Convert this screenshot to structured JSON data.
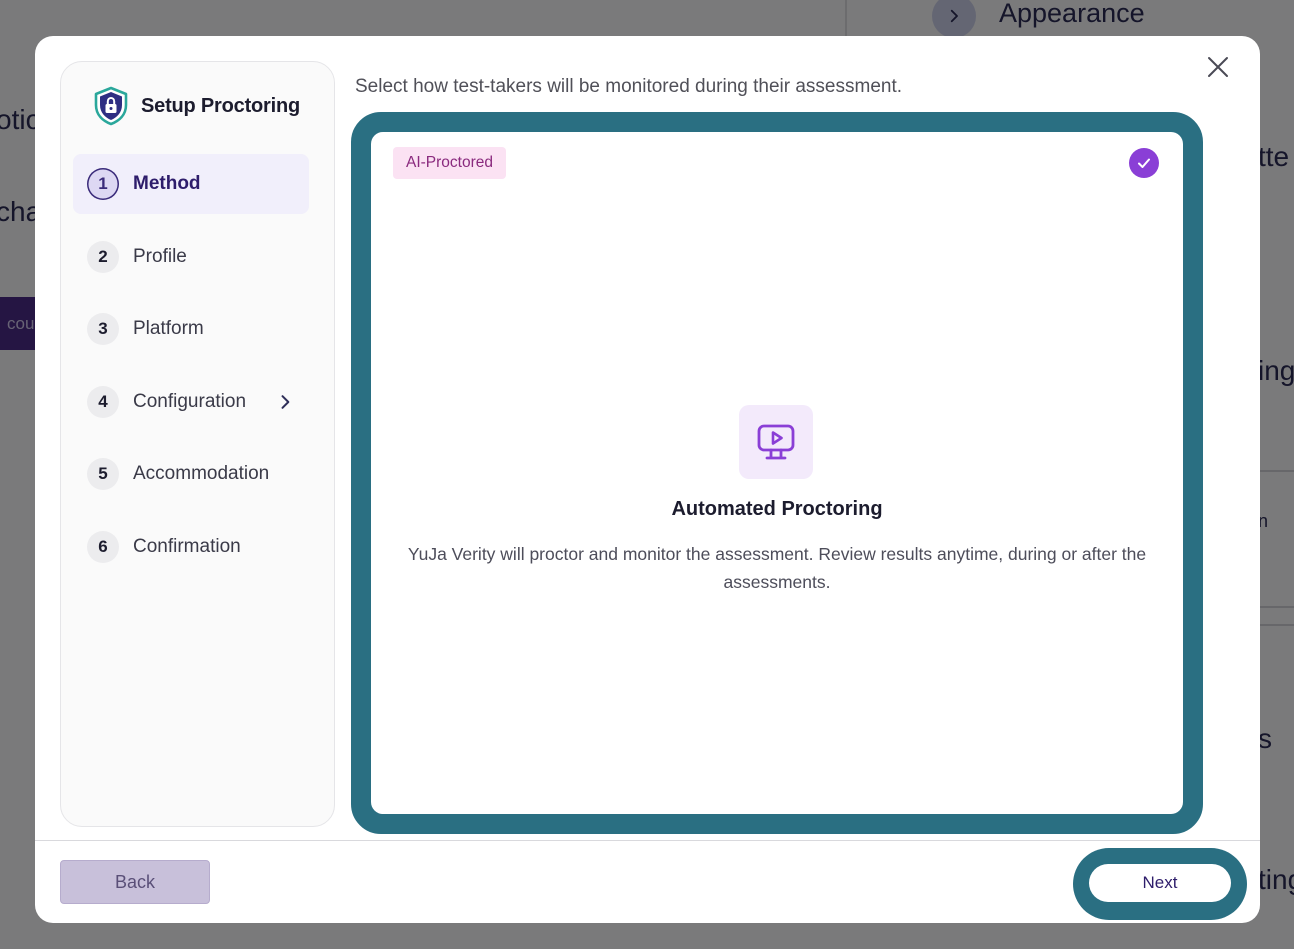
{
  "background": {
    "appearance_label": "Appearance",
    "left_fragments": [
      "otio",
      "char",
      "cou"
    ],
    "right_fragments": [
      "tte",
      "ing",
      "n",
      "s",
      "ting"
    ]
  },
  "modal": {
    "title": "Setup Proctoring",
    "instruction": "Select how test-takers will be monitored during their assessment.",
    "steps": [
      {
        "number": "1",
        "label": "Method"
      },
      {
        "number": "2",
        "label": "Profile"
      },
      {
        "number": "3",
        "label": "Platform"
      },
      {
        "number": "4",
        "label": "Configuration"
      },
      {
        "number": "5",
        "label": "Accommodation"
      },
      {
        "number": "6",
        "label": "Confirmation"
      }
    ],
    "active_step": 1,
    "option": {
      "badge": "AI-Proctored",
      "title": "Automated Proctoring",
      "description": "YuJa Verity will proctor and monitor the assessment. Review results anytime, during or after the assessments.",
      "selected": true
    },
    "footer": {
      "back_label": "Back",
      "next_label": "Next"
    }
  },
  "colors": {
    "accent_purple": "#8a3fd6",
    "focus_teal": "#2a6f82",
    "badge_bg": "#fbe2f3",
    "active_step_bg": "#f1effb"
  },
  "icons": {
    "logo": "shield-lock-icon",
    "close": "close-icon",
    "check": "check-icon",
    "option": "monitor-play-icon",
    "step_chevron": "chevron-right-icon"
  }
}
